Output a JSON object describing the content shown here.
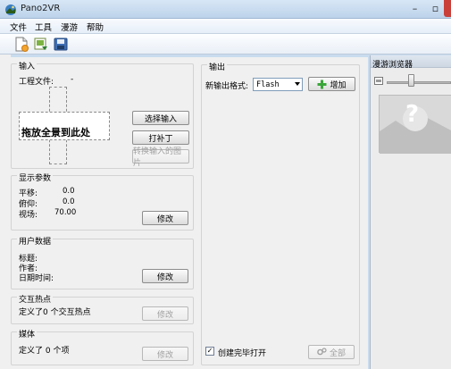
{
  "window": {
    "title": "Pano2VR"
  },
  "menu": {
    "items": [
      "文件",
      "工具",
      "漫游",
      "帮助"
    ]
  },
  "toolbar": {
    "icons": [
      "new-file-icon",
      "open-file-icon",
      "save-icon"
    ]
  },
  "input": {
    "group_title": "输入",
    "project_file_label": "工程文件:",
    "project_file_value": "-",
    "drop_text": "拖放全景到此处",
    "select_input_label": "选择输入",
    "patch_label": "打补丁",
    "convert_input_label": "转换输入的图片"
  },
  "display_params": {
    "group_title": "显示参数",
    "pan_label": "平移:",
    "pan_value": "0.0",
    "tilt_label": "俯仰:",
    "tilt_value": "0.0",
    "fov_label": "视场:",
    "fov_value": "70.00",
    "modify_label": "修改"
  },
  "user_data": {
    "group_title": "用户数据",
    "title_label": "标题:",
    "author_label": "作者:",
    "datetime_label": "日期时间:",
    "modify_label": "修改"
  },
  "hotspots": {
    "group_title": "交互热点",
    "summary": "定义了0 个交互热点",
    "modify_label": "修改"
  },
  "media": {
    "group_title": "媒体",
    "summary": "定义了 0 个项",
    "modify_label": "修改"
  },
  "output": {
    "group_title": "输出",
    "format_label": "新输出格式:",
    "format_value": "Flash",
    "add_label": "增加",
    "open_when_done_label": "创建完毕打开",
    "open_when_done_checked": "✓",
    "all_label": "全部"
  },
  "tour_browser": {
    "title": "漫游浏览器",
    "thumbnail_placeholder": "?"
  }
}
